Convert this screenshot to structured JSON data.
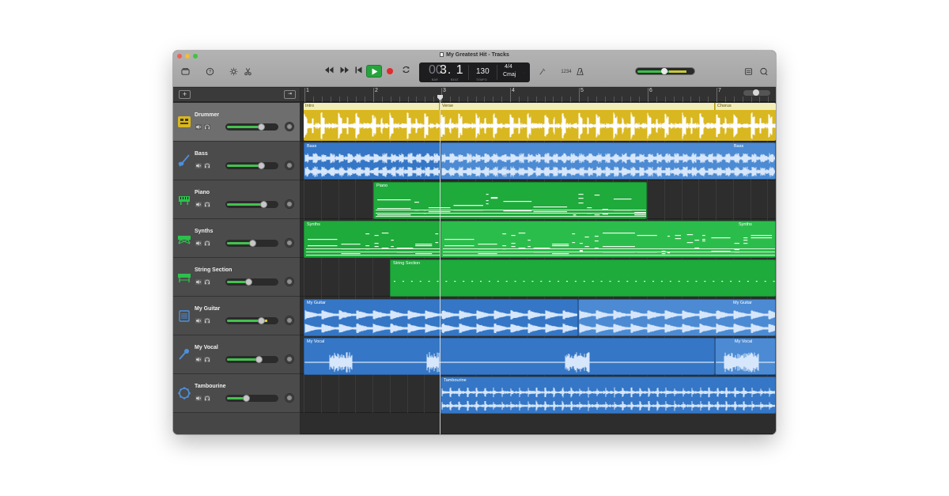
{
  "window": {
    "title": "My Greatest Hit - Tracks"
  },
  "lcd": {
    "bar": "00",
    "beat": "3. 1",
    "bar_label": "BAR",
    "beat_label": "BEAT",
    "tempo": "130",
    "tempo_label": "TEMPO",
    "signature": "4/4",
    "key": "Cmaj"
  },
  "toolbar": {
    "count_in": "1234"
  },
  "ruler": {
    "bars": [
      "1",
      "2",
      "3",
      "4",
      "5",
      "6",
      "7"
    ]
  },
  "sections": [
    "Intro",
    "Verse",
    "Chorus"
  ],
  "tracks": [
    {
      "name": "Drummer",
      "icon": "drummer-icon",
      "volume": 0.78,
      "color": "#d9b720"
    },
    {
      "name": "Bass",
      "icon": "bass-guitar-icon",
      "volume": 0.78,
      "color": "#3577c6"
    },
    {
      "name": "Piano",
      "icon": "piano-icon",
      "volume": 0.82,
      "color": "#1faa3c"
    },
    {
      "name": "Synths",
      "icon": "synth-icon",
      "volume": 0.58,
      "color": "#1faa3c"
    },
    {
      "name": "String Section",
      "icon": "strings-keyboard-icon",
      "volume": 0.5,
      "color": "#1faa3c"
    },
    {
      "name": "My Guitar",
      "icon": "amp-icon",
      "volume": 0.78,
      "color": "#3577c6"
    },
    {
      "name": "My Vocal",
      "icon": "microphone-icon",
      "volume": 0.72,
      "color": "#3577c6"
    },
    {
      "name": "Tambourine",
      "icon": "tambourine-icon",
      "volume": 0.45,
      "color": "#3577c6"
    }
  ],
  "regions": {
    "bass": "Bass",
    "bass_loop": "Bass",
    "piano": "Piano",
    "synths": "Synths",
    "synths_loop": "Synths",
    "strings": "String Section",
    "guitar": "My Guitar",
    "guitar_loop": "My Guitar",
    "vocal": "My Vocal",
    "vocal_loop": "My Vocal",
    "tambourine": "Tambourine"
  },
  "colors": {
    "drummer": "#d9b720",
    "audio": "#3577c6",
    "midi": "#1faa3c",
    "play": "#27a33d",
    "record": "#e32a2a"
  }
}
